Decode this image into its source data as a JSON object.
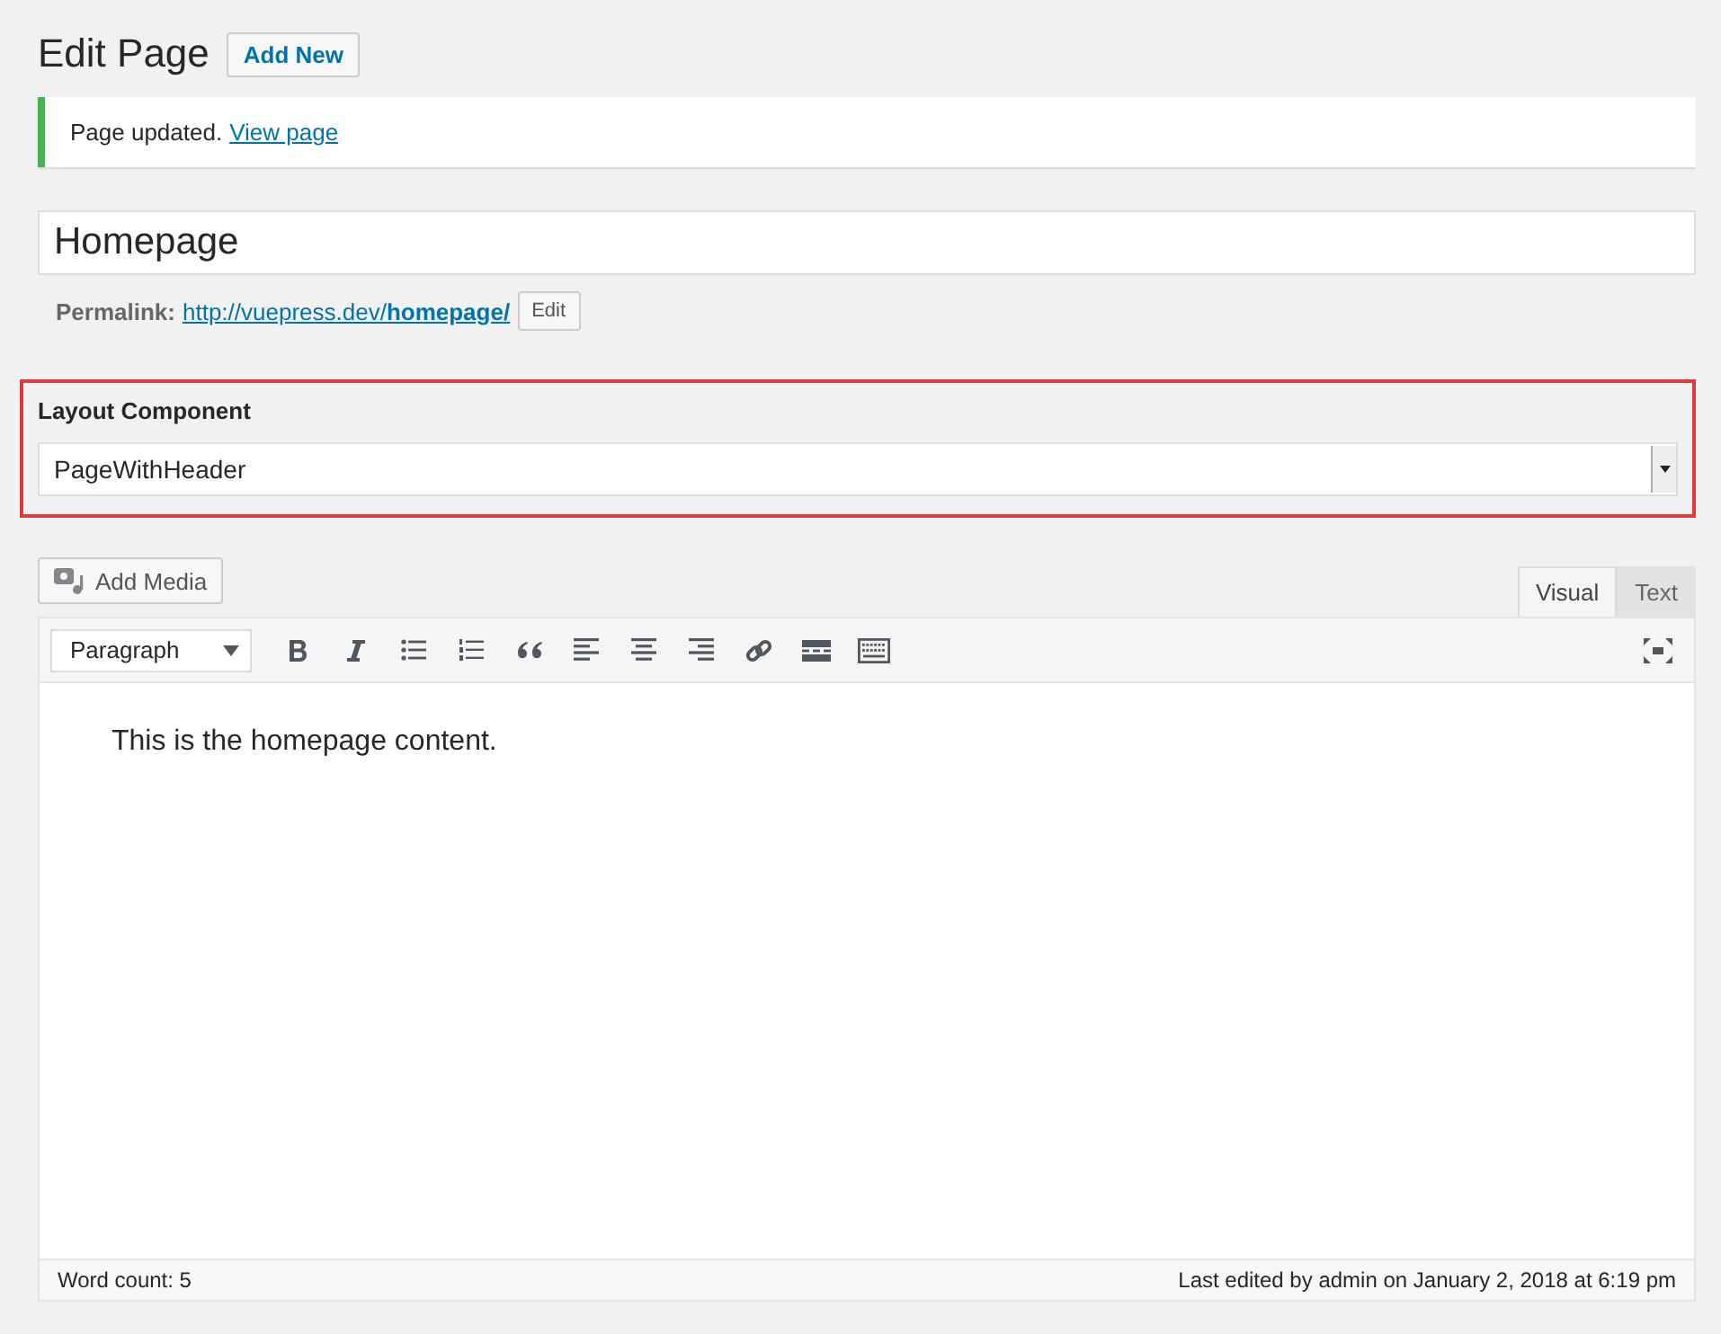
{
  "heading": {
    "title": "Edit Page",
    "add_new": "Add New"
  },
  "notice": {
    "message": "Page updated.",
    "link": "View page"
  },
  "title_field": {
    "value": "Homepage"
  },
  "permalink": {
    "label": "Permalink:",
    "url": "http://vuepress.dev/**homepage/**",
    "edit": "Edit"
  },
  "layout_component": {
    "label": "Layout Component",
    "value": "PageWithHeader"
  },
  "editor": {
    "add_media": "Add Media",
    "tabs": [
      {
        "label": "Visual",
        "selected": true
      },
      {
        "label": "Text",
        "selected": false
      }
    ],
    "format": "Paragraph",
    "toolbar": [
      {
        "kind": "bold"
      },
      {
        "kind": "italic"
      },
      {
        "kind": "bullets"
      },
      {
        "kind": "numbers"
      },
      {
        "kind": "quote"
      },
      {
        "kind": "left"
      },
      {
        "kind": "center"
      },
      {
        "kind": "right"
      },
      {
        "kind": "link"
      },
      {
        "kind": "more"
      },
      {
        "kind": "kitchen"
      }
    ],
    "content": "This is the homepage content.",
    "word_count": "Word count: 5",
    "last_edited": "Last edited by admin on January 2, 2018 at 6:19 pm"
  }
}
